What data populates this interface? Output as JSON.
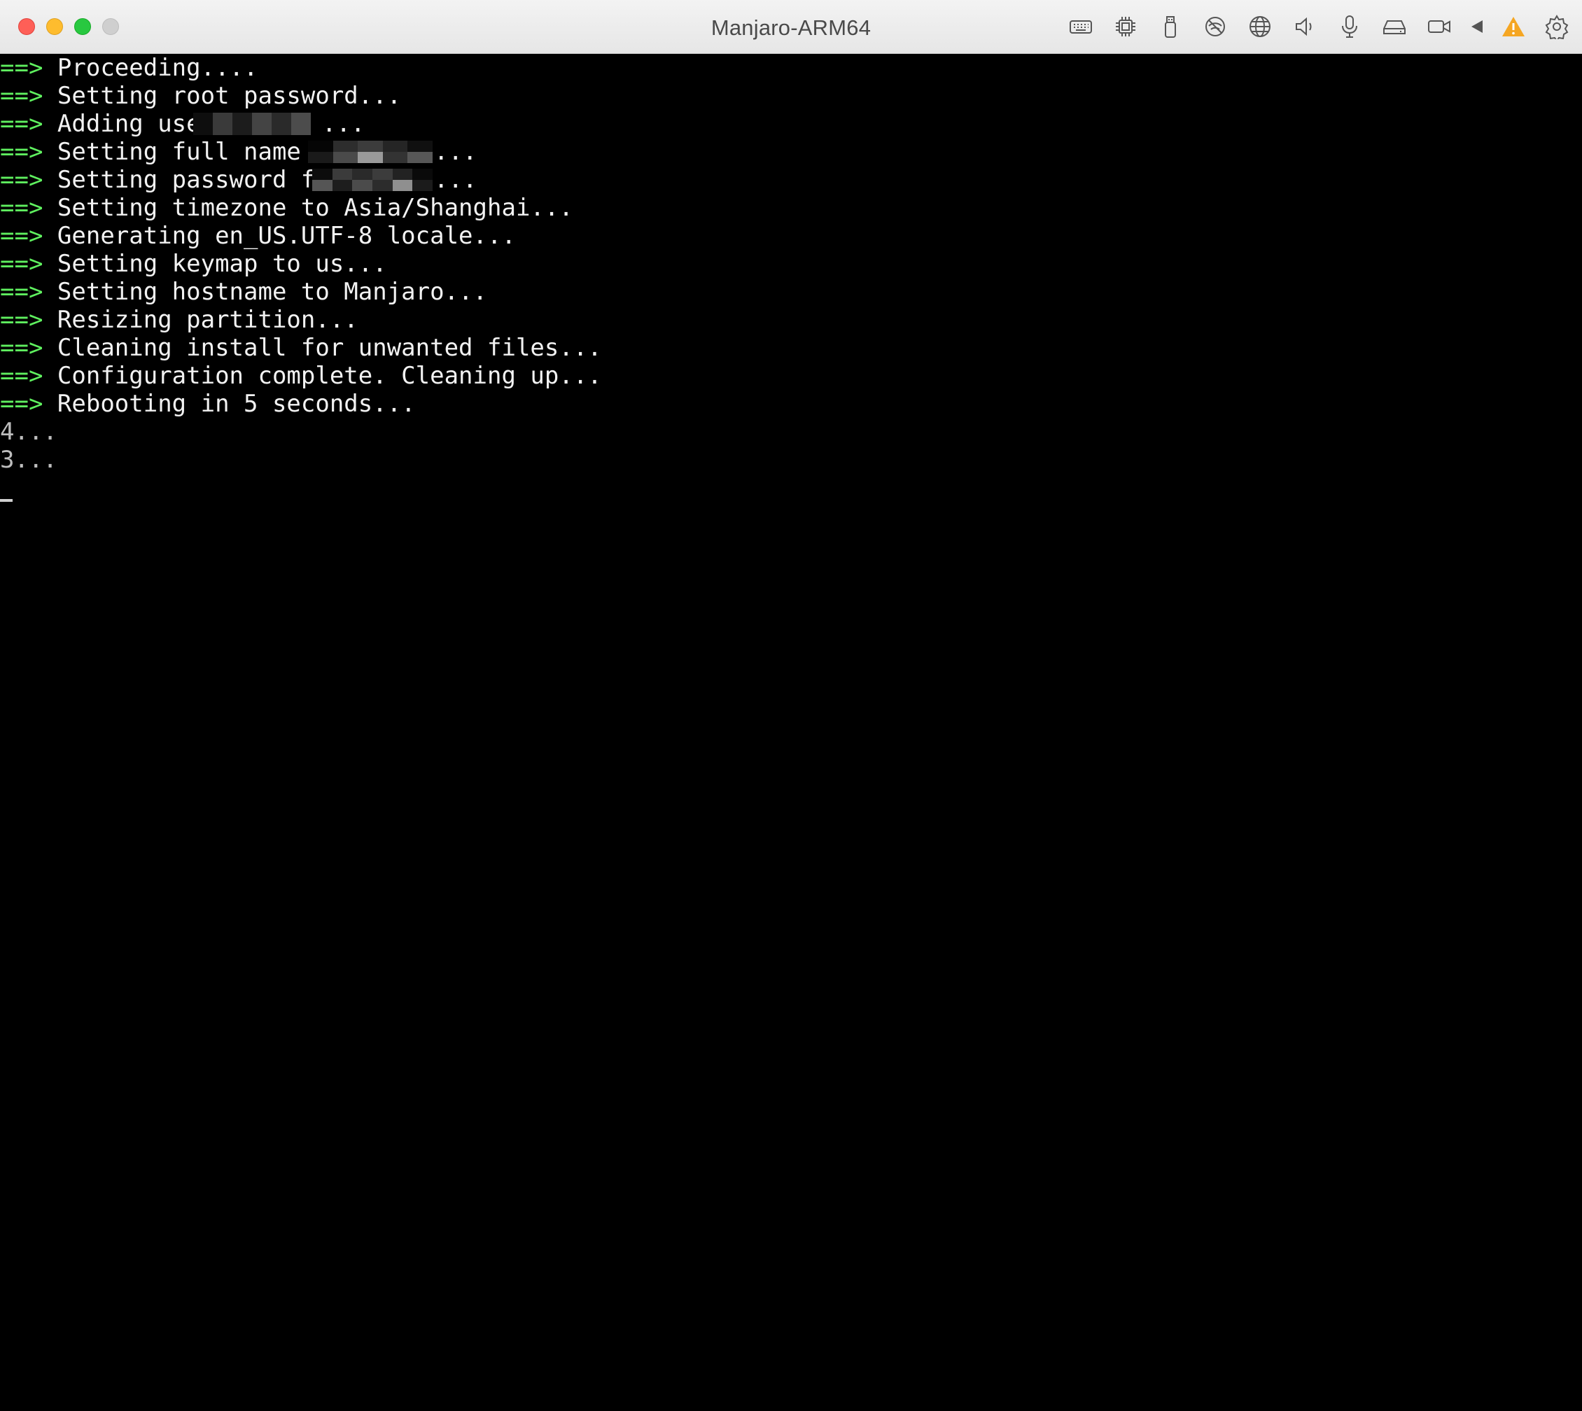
{
  "window": {
    "title": "Manjaro-ARM64"
  },
  "toolbar": {
    "icons": [
      "keyboard-icon",
      "cpu-icon",
      "usb-icon",
      "network-off-icon",
      "globe-icon",
      "speaker-icon",
      "microphone-icon",
      "disk-icon",
      "camera-icon",
      "back-icon",
      "warning-icon",
      "gear-icon"
    ],
    "warning_color": "#f5a623"
  },
  "terminal": {
    "arrow": "==>",
    "lines": [
      "Proceeding....",
      "Setting root password...",
      "Adding user",
      "Setting full name to",
      "Setting password for",
      "Setting timezone to Asia/Shanghai...",
      "Generating en_US.UTF-8 locale...",
      "Setting keymap to us...",
      "Setting hostname to Manjaro...",
      "Resizing partition...",
      "Cleaning install for unwanted files...",
      "Configuration complete. Cleaning up...",
      "Rebooting in 5 seconds..."
    ],
    "ellipsis": "...",
    "countdown": [
      "4...",
      "3..."
    ]
  },
  "colors": {
    "prompt_arrow": "#5ff05f",
    "text": "#f2f2f2",
    "background": "#000000"
  }
}
